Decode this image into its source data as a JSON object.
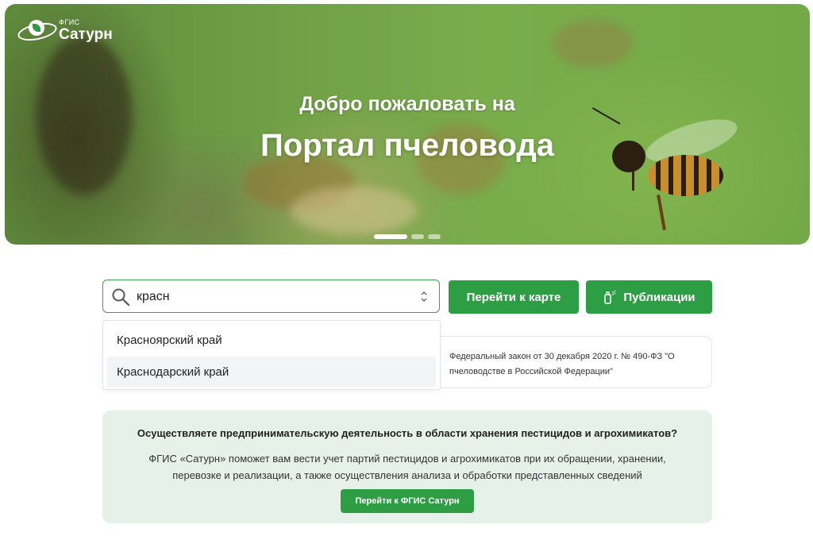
{
  "hero": {
    "logo_small": "ФГИС",
    "logo_big": "Сатурн",
    "subtitle": "Добро пожаловать на",
    "title": "Портал пчеловода",
    "carousel": {
      "slides": 3,
      "active": 1
    }
  },
  "search": {
    "value": "красн",
    "placeholder": ""
  },
  "buttons": {
    "map": "Перейти к карте",
    "publications": "Публикации"
  },
  "dropdown": {
    "options": [
      "Красноярский край",
      "Краснодарский край"
    ],
    "highlighted_index": 1
  },
  "news": {
    "text": "Федеральный закон от 30 декабря 2020 г. № 490-ФЗ \"О пчеловодстве в Российской Федерации\""
  },
  "info": {
    "question": "Осуществляете предпринимательскую деятельность в области хранения пестицидов и агрохимикатов?",
    "description": "ФГИС «Сатурн» поможет вам вести учет партий пестицидов и агрохимикатов при их обращении, хранении, перевозке и реализации, а также осуществления анализа и обработки представленных сведений",
    "button": "Перейти к ФГИС Сатурн"
  },
  "colors": {
    "accent": "#2e9e45",
    "info_bg": "#e6f1e9",
    "search_border": "#3aa150"
  },
  "icons": [
    "logo-icon",
    "search-icon",
    "sort-arrows-icon",
    "spray-icon"
  ]
}
